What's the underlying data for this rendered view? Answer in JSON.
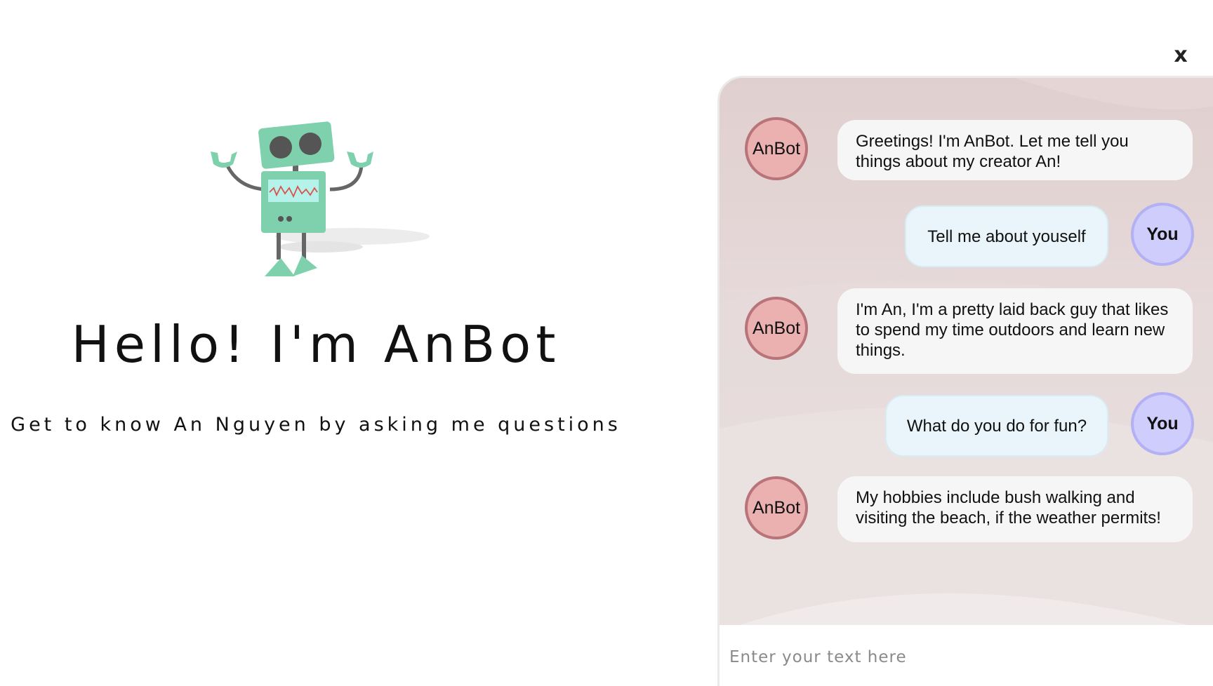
{
  "hero": {
    "title": "Hello! I'm AnBot",
    "subtitle": "Get to know An Nguyen by asking me questions"
  },
  "close": {
    "label": "x"
  },
  "chat": {
    "messages": [
      {
        "sender": "bot",
        "avatar": "AnBot",
        "text": "Greetings! I'm AnBot. Let me tell you things about my creator An!"
      },
      {
        "sender": "user",
        "avatar": "You",
        "text": "Tell me about youself"
      },
      {
        "sender": "bot",
        "avatar": "AnBot",
        "text": "I'm An, I'm a pretty laid back guy that likes to spend my time outdoors and learn new things."
      },
      {
        "sender": "user",
        "avatar": "You",
        "text": "What do you do for fun?"
      },
      {
        "sender": "bot",
        "avatar": "AnBot",
        "text": "My hobbies include bush walking and visiting the beach, if the weather permits!"
      }
    ],
    "input": {
      "placeholder": "Enter your text here",
      "value": ""
    }
  },
  "colors": {
    "bot_avatar": "#ebb0b0",
    "user_avatar": "#cfcdfb",
    "robot_green": "#7fd1ae"
  }
}
